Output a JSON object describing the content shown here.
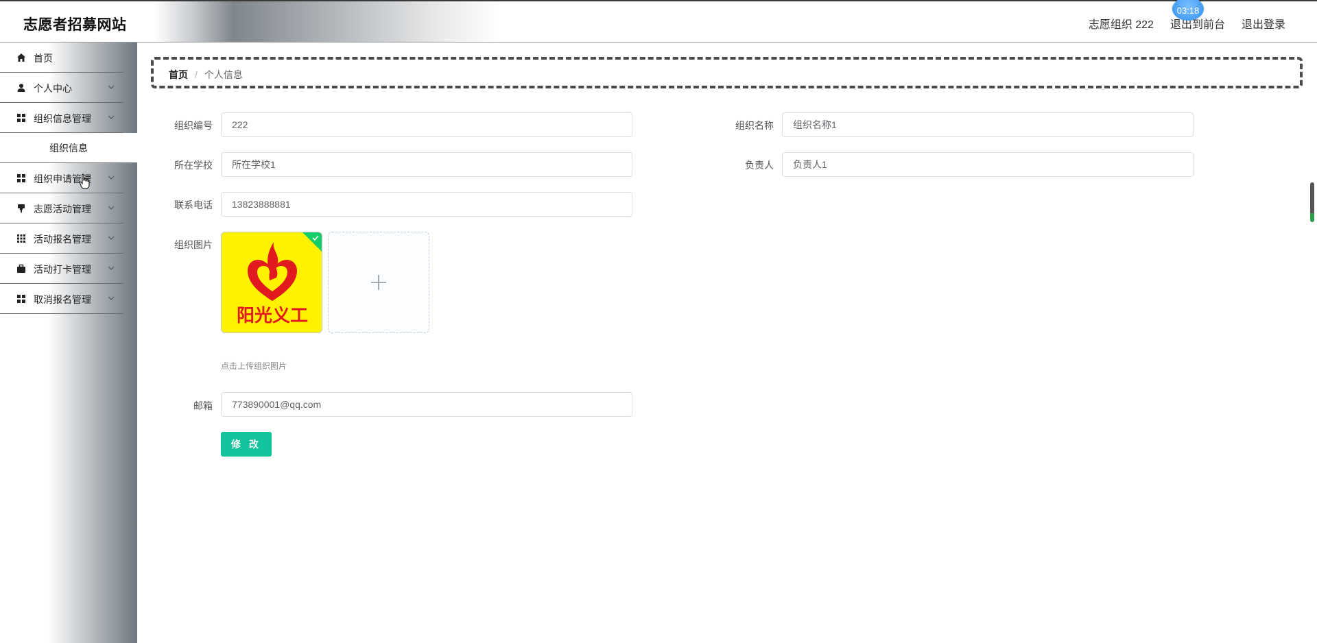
{
  "header": {
    "brand": "志愿者招募网站",
    "user": "志愿组织 222",
    "front_link": "退出到前台",
    "logout": "退出登录",
    "timer": "03:18"
  },
  "sidebar": {
    "items": [
      {
        "label": "首页",
        "icon": "home-icon"
      },
      {
        "label": "个人中心",
        "icon": "user-icon"
      },
      {
        "label": "组织信息管理",
        "icon": "grid-icon"
      },
      {
        "label": "组织申请管理",
        "icon": "grid-icon"
      },
      {
        "label": "志愿活动管理",
        "icon": "flag-icon"
      },
      {
        "label": "活动报名管理",
        "icon": "apps-icon"
      },
      {
        "label": "活动打卡管理",
        "icon": "briefcase-icon"
      },
      {
        "label": "取消报名管理",
        "icon": "grid-icon"
      }
    ],
    "submenu": {
      "label": "组织信息"
    }
  },
  "breadcrumb": {
    "home": "首页",
    "separator": "/",
    "current": "个人信息"
  },
  "form": {
    "org_id": {
      "label": "组织编号",
      "value": "222"
    },
    "org_name": {
      "label": "组织名称",
      "value": "组织名称1"
    },
    "school": {
      "label": "所在学校",
      "value": "所在学校1"
    },
    "leader": {
      "label": "负责人",
      "value": "负责人1"
    },
    "phone": {
      "label": "联系电话",
      "value": "13823888881"
    },
    "image": {
      "label": "组织图片",
      "hint": "点击上传组织图片",
      "logo_text": "阳光义工"
    },
    "email": {
      "label": "邮箱",
      "value": "773890001@qq.com"
    },
    "submit": "修 改"
  },
  "colors": {
    "accent": "#13c39b",
    "logo_bg": "#fff200",
    "logo_red": "#e11a1f"
  }
}
